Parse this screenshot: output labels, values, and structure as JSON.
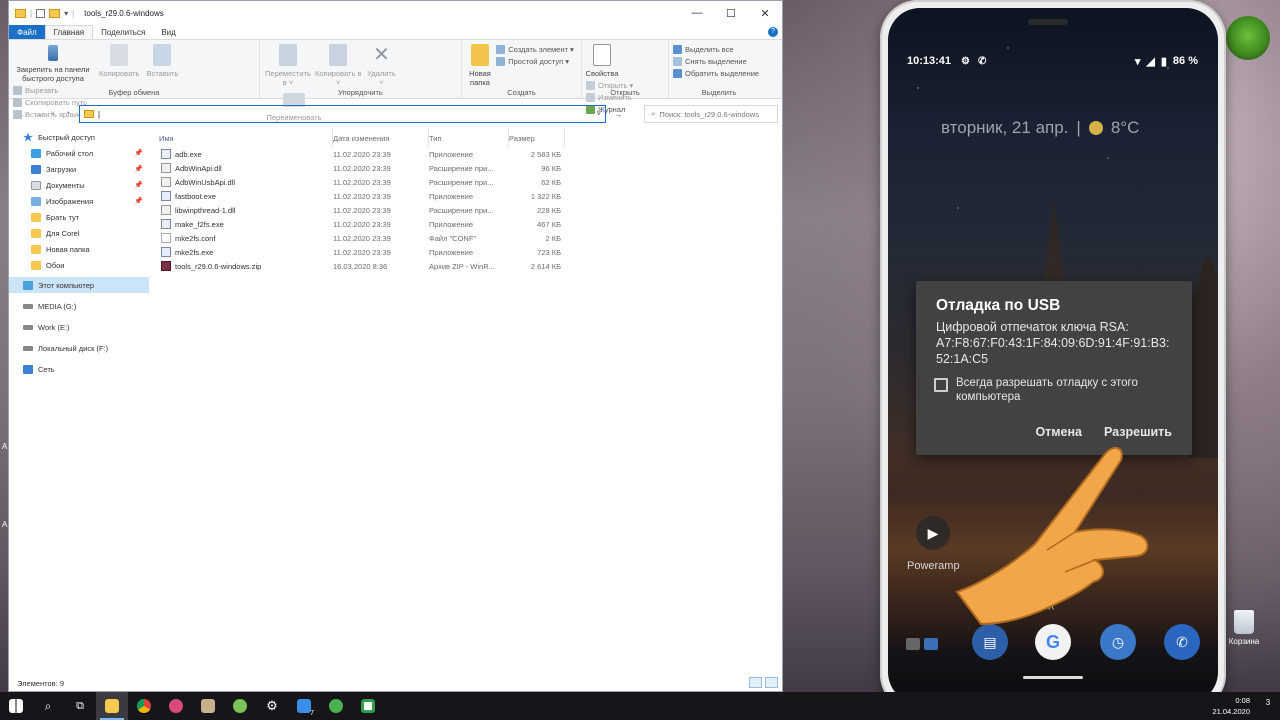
{
  "explorer": {
    "title": "tools_r29.0.6-windows",
    "window_controls": [
      "—",
      "☐",
      "✕"
    ],
    "tabs": [
      "Файл",
      "Главная",
      "Поделиться",
      "Вид"
    ],
    "ribbon": {
      "clipboard": {
        "pin_label": "Закрепить на панели быстрого доступа",
        "copy_label": "Копировать",
        "paste_label": "Вставить",
        "cut_label": "Вырезать",
        "copy_path_label": "Скопировать путь",
        "paste_shortcut_label": "Вставить ярлык",
        "group_name": "Буфер обмена"
      },
      "organize": {
        "move_label": "Переместить в ˅",
        "copy_to_label": "Копировать в ˅",
        "delete_label": "Удалить ˅",
        "rename_label": "Переименовать",
        "group_name": "Упорядочить"
      },
      "create": {
        "new_folder_label": "Новая папка",
        "new_item_label": "Создать элемент ▾",
        "easy_access_label": "Простой доступ ▾",
        "group_name": "Создать"
      },
      "open": {
        "properties_label": "Свойства",
        "open_label": "Открыть ▾",
        "edit_label": "Изменить",
        "history_label": "Журнал",
        "group_name": "Открыть"
      },
      "select": {
        "select_all_label": "Выделить все",
        "select_none_label": "Снять выделение",
        "invert_label": "Обратить выделение",
        "group_name": "Выделить"
      }
    },
    "address_value": "",
    "search_placeholder": "Поиск: tools_r29.0.6-windows",
    "nav": [
      {
        "label": "Быстрый доступ",
        "pinned": false
      },
      {
        "label": "Рабочий стол",
        "pinned": true
      },
      {
        "label": "Загрузки",
        "pinned": true
      },
      {
        "label": "Документы",
        "pinned": true
      },
      {
        "label": "Изображения",
        "pinned": true
      },
      {
        "label": "Брать тут",
        "pinned": false
      },
      {
        "label": "Для Corel",
        "pinned": false
      },
      {
        "label": "Новая папка",
        "pinned": false
      },
      {
        "label": "Обои",
        "pinned": false
      },
      {
        "label": "Этот компьютер",
        "pinned": false
      },
      {
        "label": "MEDIA (G:)",
        "pinned": false
      },
      {
        "label": "Work (E:)",
        "pinned": false
      },
      {
        "label": "Локальный диск (F:)",
        "pinned": false
      },
      {
        "label": "Сеть",
        "pinned": false
      }
    ],
    "columns": [
      "Имя",
      "Дата изменения",
      "Тип",
      "Размер"
    ],
    "files": [
      {
        "name": "adb.exe",
        "date": "11.02.2020 23:39",
        "type": "Приложение",
        "size": "2 583 КБ",
        "kind": "exe"
      },
      {
        "name": "AdbWinApi.dll",
        "date": "11.02.2020 23:39",
        "type": "Расширение при...",
        "size": "96 КБ",
        "kind": "dll"
      },
      {
        "name": "AdbWinUsbApi.dll",
        "date": "11.02.2020 23:39",
        "type": "Расширение при...",
        "size": "62 КБ",
        "kind": "dll"
      },
      {
        "name": "fastboot.exe",
        "date": "11.02.2020 23:39",
        "type": "Приложение",
        "size": "1 322 КБ",
        "kind": "exe"
      },
      {
        "name": "libwinpthread-1.dll",
        "date": "11.02.2020 23:39",
        "type": "Расширение при...",
        "size": "228 КБ",
        "kind": "dll"
      },
      {
        "name": "make_f2fs.exe",
        "date": "11.02.2020 23:39",
        "type": "Приложение",
        "size": "467 КБ",
        "kind": "exe"
      },
      {
        "name": "mke2fs.conf",
        "date": "11.02.2020 23:39",
        "type": "Файл \"CONF\"",
        "size": "2 КБ",
        "kind": "conf"
      },
      {
        "name": "mke2fs.exe",
        "date": "11.02.2020 23:39",
        "type": "Приложение",
        "size": "723 КБ",
        "kind": "exe"
      },
      {
        "name": "tools_r29.0.6-windows.zip",
        "date": "16.03.2020 8:36",
        "type": "Архив ZIP - WinR...",
        "size": "2 614 КБ",
        "kind": "zip"
      }
    ],
    "status": "Элементов: 9"
  },
  "phone": {
    "time": "10:13:41",
    "battery": "86 %",
    "date_text": "вторник, 21 апр.",
    "temperature": "8°C",
    "dialog": {
      "title": "Отладка по USB",
      "fingerprint_label": "Цифровой отпечаток ключа RSA:",
      "fingerprint": "A7:F8:67:F0:43:1F:84:09:6D:91:4F:91:B3:52:1A:C5",
      "checkbox_label": "Всегда разрешать отладку с этого компьютера",
      "cancel_label": "Отмена",
      "allow_label": "Разрешить"
    },
    "app_label": "Poweramp"
  },
  "desktop": {
    "recycle_label": "Корзина"
  },
  "taskbar": {
    "time": "0:08",
    "date": "21.04.2020",
    "notif_count": "3",
    "badge": "7"
  },
  "colors": {
    "accent": "#1a6fc7",
    "dialog_bg": "#424242",
    "taskbar_bg": "#16161a"
  }
}
